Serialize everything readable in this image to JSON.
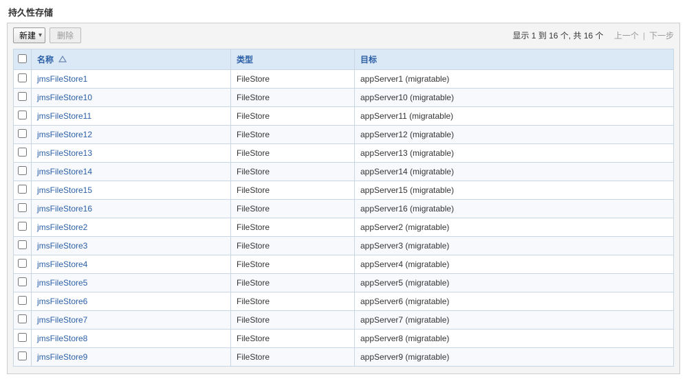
{
  "pageTitle": "持久性存储",
  "toolbar": {
    "newLabel": "新建",
    "deleteLabel": "删除"
  },
  "pager": {
    "summary": "显示 1 到 16 个, 共 16 个",
    "prev": "上一个",
    "next": "下一步"
  },
  "columns": {
    "name": "名称",
    "type": "类型",
    "target": "目标"
  },
  "rows": [
    {
      "name": "jmsFileStore1",
      "type": "FileStore",
      "target": "appServer1 (migratable)"
    },
    {
      "name": "jmsFileStore10",
      "type": "FileStore",
      "target": "appServer10 (migratable)"
    },
    {
      "name": "jmsFileStore11",
      "type": "FileStore",
      "target": "appServer11 (migratable)"
    },
    {
      "name": "jmsFileStore12",
      "type": "FileStore",
      "target": "appServer12 (migratable)"
    },
    {
      "name": "jmsFileStore13",
      "type": "FileStore",
      "target": "appServer13 (migratable)"
    },
    {
      "name": "jmsFileStore14",
      "type": "FileStore",
      "target": "appServer14 (migratable)"
    },
    {
      "name": "jmsFileStore15",
      "type": "FileStore",
      "target": "appServer15 (migratable)"
    },
    {
      "name": "jmsFileStore16",
      "type": "FileStore",
      "target": "appServer16 (migratable)"
    },
    {
      "name": "jmsFileStore2",
      "type": "FileStore",
      "target": "appServer2 (migratable)"
    },
    {
      "name": "jmsFileStore3",
      "type": "FileStore",
      "target": "appServer3 (migratable)"
    },
    {
      "name": "jmsFileStore4",
      "type": "FileStore",
      "target": "appServer4 (migratable)"
    },
    {
      "name": "jmsFileStore5",
      "type": "FileStore",
      "target": "appServer5 (migratable)"
    },
    {
      "name": "jmsFileStore6",
      "type": "FileStore",
      "target": "appServer6 (migratable)"
    },
    {
      "name": "jmsFileStore7",
      "type": "FileStore",
      "target": "appServer7 (migratable)"
    },
    {
      "name": "jmsFileStore8",
      "type": "FileStore",
      "target": "appServer8 (migratable)"
    },
    {
      "name": "jmsFileStore9",
      "type": "FileStore",
      "target": "appServer9 (migratable)"
    }
  ]
}
